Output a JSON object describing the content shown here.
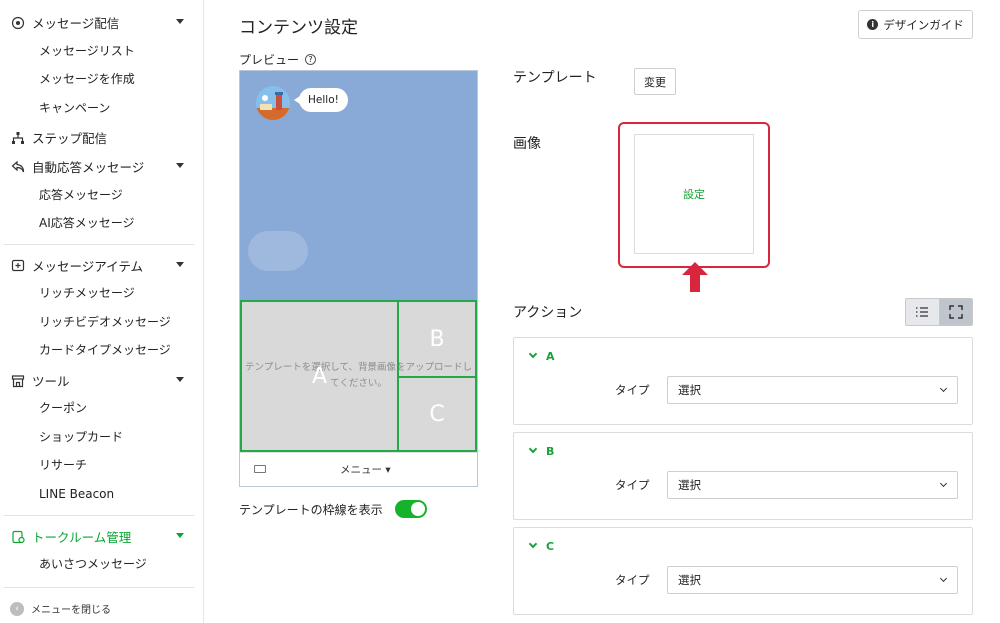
{
  "sidebar": {
    "groups": [
      {
        "label": "メッセージ配信",
        "items": [
          "メッセージリスト",
          "メッセージを作成",
          "キャンペーン"
        ]
      },
      {
        "label": "ステップ配信"
      },
      {
        "label": "自動応答メッセージ",
        "items": [
          "応答メッセージ",
          "AI応答メッセージ"
        ]
      },
      {
        "label": "メッセージアイテム",
        "items": [
          "リッチメッセージ",
          "リッチビデオメッセージ",
          "カードタイプメッセージ"
        ]
      },
      {
        "label": "ツール",
        "items": [
          "クーポン",
          "ショップカード",
          "リサーチ",
          "LINE Beacon"
        ]
      },
      {
        "label": "トークルーム管理",
        "items": [
          "あいさつメッセージ"
        ]
      }
    ],
    "close_label": "メニューを閉じる",
    "active_color": "#08a530"
  },
  "header": {
    "title": "コンテンツ設定",
    "design_guide_label": "デザインガイド"
  },
  "preview": {
    "label": "プレビュー",
    "bubble_text": "Hello!",
    "hint": "テンプレートを選択して、背景画像をアップロードしてください。",
    "areas": [
      "A",
      "B",
      "C"
    ],
    "menu_label": "メニュー ▾",
    "toggle_label": "テンプレートの枠線を表示",
    "toggle_on": true,
    "bg_color": "#89aad6",
    "area_border_color": "#23a94a"
  },
  "template": {
    "label": "テンプレート",
    "change_label": "変更"
  },
  "image": {
    "label": "画像",
    "set_label": "設定",
    "highlight_color": "#d7263d"
  },
  "actions": {
    "label": "アクション",
    "type_label": "タイプ",
    "items": [
      {
        "name": "A",
        "type": "選択"
      },
      {
        "name": "B",
        "type": "選択"
      },
      {
        "name": "C",
        "type": "選択"
      }
    ]
  }
}
